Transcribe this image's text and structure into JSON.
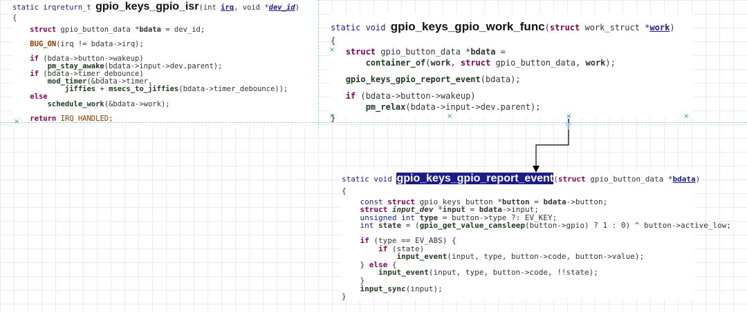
{
  "isr": {
    "l1": {
      "a": "static irqreturn_t ",
      "name": "gpio_keys_gpio_isr",
      "b": "(int ",
      "p1": "irq",
      "c": ", void *",
      "p2": "dev_id",
      "d": ")"
    },
    "l2": "{",
    "l3": {
      "kw": "struct",
      "a": " gpio_button_data *",
      "b": "bdata",
      "c": " = dev_id;"
    },
    "l4": {
      "mac": "BUG_ON",
      "a": "(irq != bdata->irq);"
    },
    "l5": {
      "kw": "if",
      "a": " (bdata->button->wakeup)"
    },
    "l6": {
      "fn": "pm_stay_awake",
      "a": "(bdata->input->dev.parent);"
    },
    "l7": {
      "kw": "if",
      "a": " (bdata->timer_debounce)"
    },
    "l8": {
      "fn": "mod_timer",
      "a": "(&bdata->timer,"
    },
    "l9": {
      "fn1": "jiffies",
      "a": " + ",
      "fn2": "msecs_to_jiffies",
      "b": "(bdata->timer_debounce));"
    },
    "l10": {
      "kw": "else"
    },
    "l11": {
      "fn": "schedule_work",
      "a": "(&bdata->work);"
    },
    "l12": {
      "kw": "return",
      "a": " IRQ_HANDLED;"
    }
  },
  "work": {
    "l1": {
      "a": "static void ",
      "name": "gpio_keys_gpio_work_func",
      "b": "(",
      "kw": "struct",
      "c": " work_struct *",
      "p": "work",
      "d": ")"
    },
    "l2": "{",
    "l3": {
      "kw": "struct",
      "a": " gpio_button_data *",
      "b": "bdata",
      "c": " ="
    },
    "l4": {
      "fn": "container_of",
      "a": "(",
      "b": "work",
      "c": ", ",
      "kw": "struct",
      "d": " gpio_button_data, ",
      "e": "work",
      "f": ");"
    },
    "l5": {
      "fn": "gpio_keys_gpio_report_event",
      "a": "(bdata);"
    },
    "l6": {
      "kw": "if",
      "a": " (bdata->button->wakeup)"
    },
    "l7": {
      "fn": "pm_relax",
      "a": "(bdata->input->dev.parent);"
    },
    "l8": "}"
  },
  "report": {
    "l1": {
      "a": "static void ",
      "name": "gpio_keys_gpio_report_event",
      "b": "(",
      "kw": "struct",
      "c": " gpio_button_data *",
      "p": "bdata",
      "d": ")"
    },
    "l2": "{",
    "l3": {
      "a": "const ",
      "kw": "struct",
      "b": " gpio_keys_button *",
      "c": "button",
      "d": " = ",
      "e": "bdata",
      "f": "->button;"
    },
    "l4": {
      "kw": "struct",
      "a": " input_dev",
      "b": " *",
      "c": "input",
      "d": " = ",
      "e": "bdata",
      "f": "->input;"
    },
    "l5": {
      "a": "unsigned int ",
      "b": "type",
      "c": " = button->type ?: EV_KEY;"
    },
    "l6": {
      "a": "int ",
      "b": "state",
      "c": " = (",
      "fn": "gpio_get_value_cansleep",
      "d": "(button->gpio) ? 1 : 0) ^ button->active_low;"
    },
    "l7": {
      "kw": "if",
      "a": " (type == EV_ABS) {"
    },
    "l8": {
      "kw": "if",
      "a": " (state)"
    },
    "l9": {
      "fn": "input_event",
      "a": "(input, type, button->code, button->value);"
    },
    "l10": {
      "a": "} ",
      "kw": "else",
      "b": " {"
    },
    "l11": {
      "fn": "input_event",
      "a": "(input, type, button->code, !!state);"
    },
    "l12": "}",
    "l13": {
      "fn": "input_sync",
      "a": "(input);"
    },
    "l14": "}"
  },
  "markers": {
    "x": "×"
  }
}
